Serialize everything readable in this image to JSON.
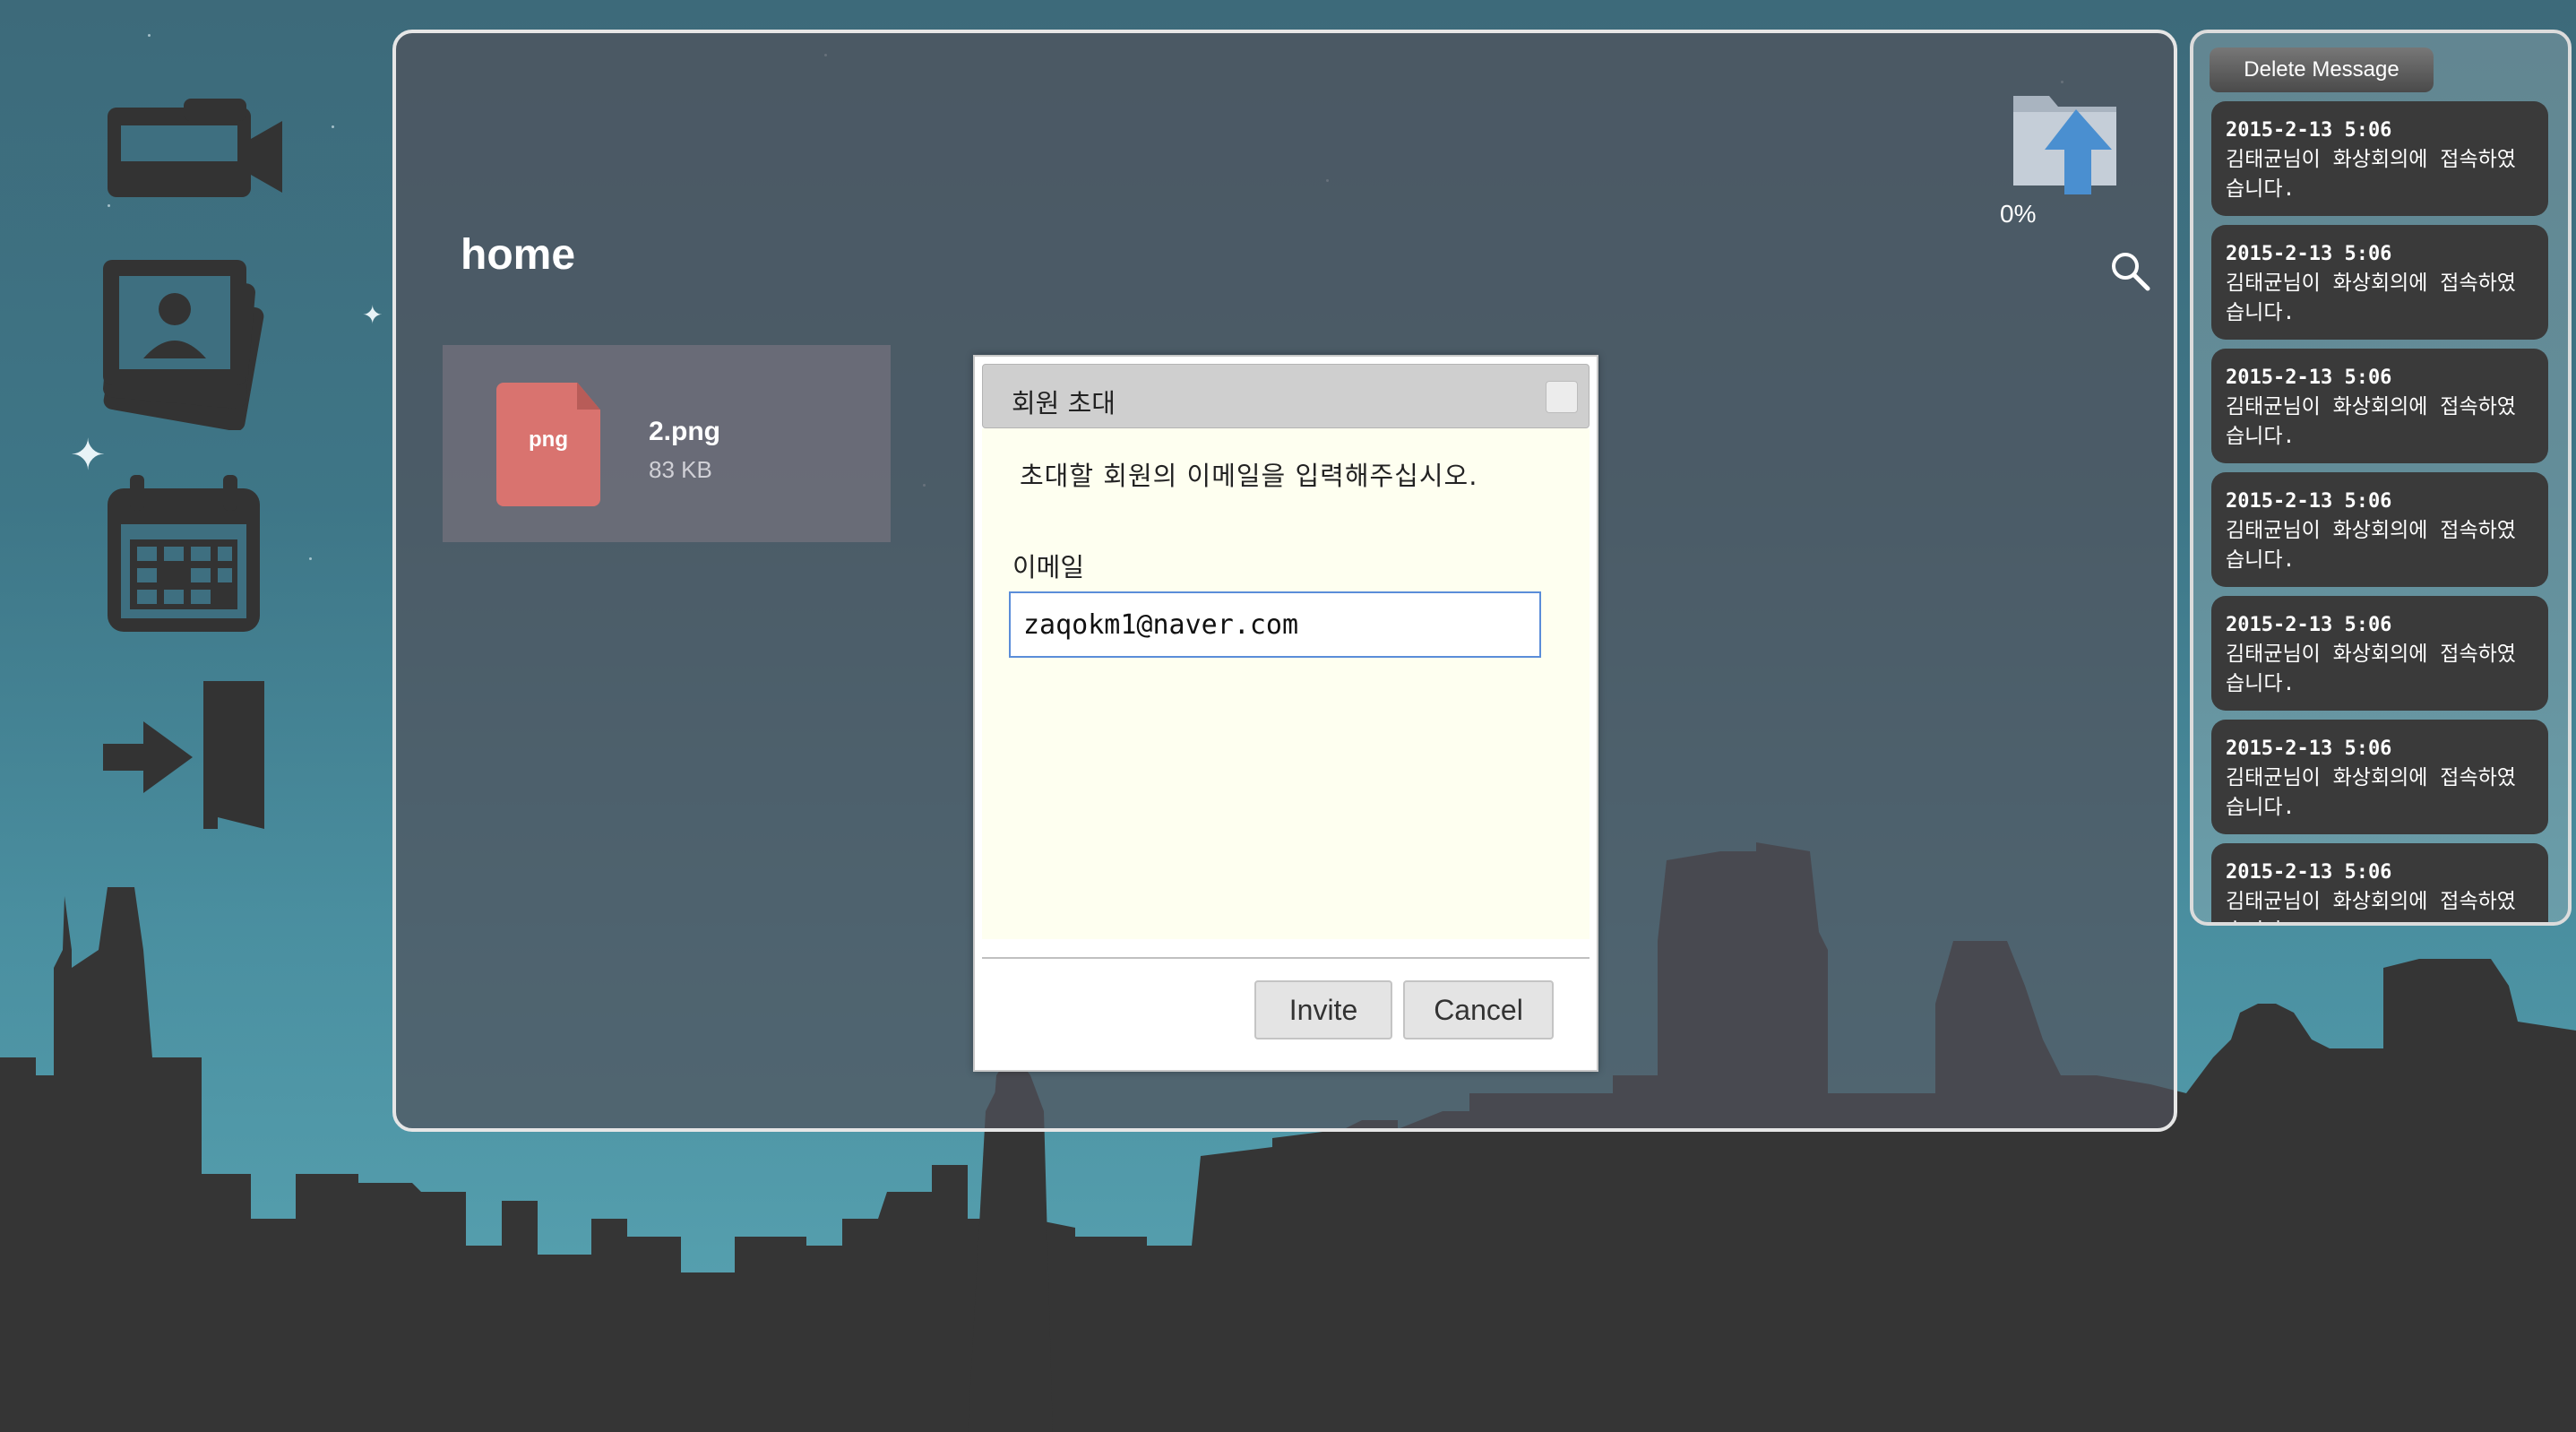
{
  "sidebar": {
    "items": [
      {
        "name": "video-conference",
        "icon": "video-camera-icon"
      },
      {
        "name": "photos",
        "icon": "photo-gallery-icon"
      },
      {
        "name": "calendar",
        "icon": "calendar-icon"
      },
      {
        "name": "logout",
        "icon": "exit-door-icon"
      }
    ]
  },
  "main": {
    "folder_title": "home",
    "upload_progress": "0%",
    "files": [
      {
        "type_label": "png",
        "name": "2.png",
        "size": "83 KB"
      }
    ]
  },
  "dialog": {
    "title": "회원 초대",
    "message": "초대할 회원의 이메일을 입력해주십시오.",
    "email_label": "이메일",
    "email_value": "zaqokm1@naver.com",
    "invite_label": "Invite",
    "cancel_label": "Cancel"
  },
  "messages": {
    "delete_label": "Delete Message",
    "items": [
      {
        "time": "2015-2-13 5:06",
        "text": "김태균님이 화상회의에 접속하였습니다."
      },
      {
        "time": "2015-2-13 5:06",
        "text": "김태균님이 화상회의에 접속하였습니다."
      },
      {
        "time": "2015-2-13 5:06",
        "text": "김태균님이 화상회의에 접속하였습니다."
      },
      {
        "time": "2015-2-13 5:06",
        "text": "김태균님이 화상회의에 접속하였습니다."
      },
      {
        "time": "2015-2-13 5:06",
        "text": "김태균님이 화상회의에 접속하였습니다."
      },
      {
        "time": "2015-2-13 5:06",
        "text": "김태균님이 화상회의에 접속하였습니다."
      },
      {
        "time": "2015-2-13 5:06",
        "text": "김태균님이 화상회의에 접속하였습니다."
      }
    ]
  },
  "colors": {
    "file_badge": "#d9736f",
    "input_border": "#5b8dd9",
    "dialog_body": "#fefff0",
    "message_bg": "#3a3a3a",
    "skyline": "#353535"
  }
}
